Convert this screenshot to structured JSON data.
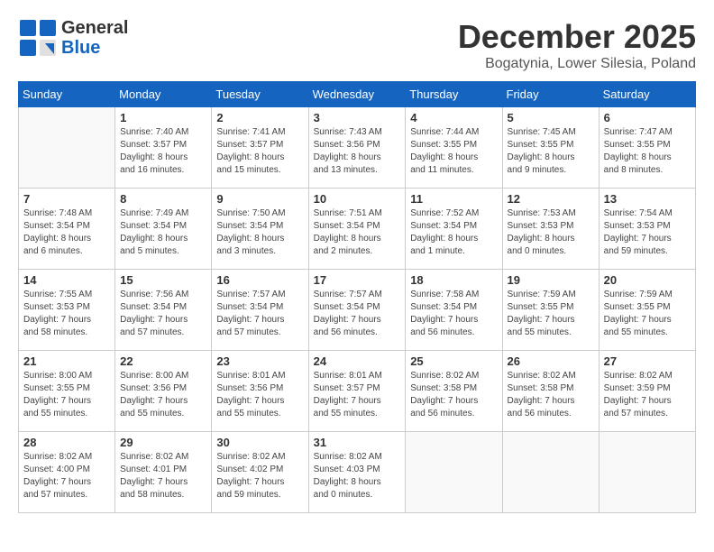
{
  "header": {
    "logo_line1": "General",
    "logo_line2": "Blue",
    "month": "December 2025",
    "location": "Bogatynia, Lower Silesia, Poland"
  },
  "weekdays": [
    "Sunday",
    "Monday",
    "Tuesday",
    "Wednesday",
    "Thursday",
    "Friday",
    "Saturday"
  ],
  "weeks": [
    [
      {
        "day": "",
        "info": ""
      },
      {
        "day": "1",
        "info": "Sunrise: 7:40 AM\nSunset: 3:57 PM\nDaylight: 8 hours\nand 16 minutes."
      },
      {
        "day": "2",
        "info": "Sunrise: 7:41 AM\nSunset: 3:57 PM\nDaylight: 8 hours\nand 15 minutes."
      },
      {
        "day": "3",
        "info": "Sunrise: 7:43 AM\nSunset: 3:56 PM\nDaylight: 8 hours\nand 13 minutes."
      },
      {
        "day": "4",
        "info": "Sunrise: 7:44 AM\nSunset: 3:55 PM\nDaylight: 8 hours\nand 11 minutes."
      },
      {
        "day": "5",
        "info": "Sunrise: 7:45 AM\nSunset: 3:55 PM\nDaylight: 8 hours\nand 9 minutes."
      },
      {
        "day": "6",
        "info": "Sunrise: 7:47 AM\nSunset: 3:55 PM\nDaylight: 8 hours\nand 8 minutes."
      }
    ],
    [
      {
        "day": "7",
        "info": "Sunrise: 7:48 AM\nSunset: 3:54 PM\nDaylight: 8 hours\nand 6 minutes."
      },
      {
        "day": "8",
        "info": "Sunrise: 7:49 AM\nSunset: 3:54 PM\nDaylight: 8 hours\nand 5 minutes."
      },
      {
        "day": "9",
        "info": "Sunrise: 7:50 AM\nSunset: 3:54 PM\nDaylight: 8 hours\nand 3 minutes."
      },
      {
        "day": "10",
        "info": "Sunrise: 7:51 AM\nSunset: 3:54 PM\nDaylight: 8 hours\nand 2 minutes."
      },
      {
        "day": "11",
        "info": "Sunrise: 7:52 AM\nSunset: 3:54 PM\nDaylight: 8 hours\nand 1 minute."
      },
      {
        "day": "12",
        "info": "Sunrise: 7:53 AM\nSunset: 3:53 PM\nDaylight: 8 hours\nand 0 minutes."
      },
      {
        "day": "13",
        "info": "Sunrise: 7:54 AM\nSunset: 3:53 PM\nDaylight: 7 hours\nand 59 minutes."
      }
    ],
    [
      {
        "day": "14",
        "info": "Sunrise: 7:55 AM\nSunset: 3:53 PM\nDaylight: 7 hours\nand 58 minutes."
      },
      {
        "day": "15",
        "info": "Sunrise: 7:56 AM\nSunset: 3:54 PM\nDaylight: 7 hours\nand 57 minutes."
      },
      {
        "day": "16",
        "info": "Sunrise: 7:57 AM\nSunset: 3:54 PM\nDaylight: 7 hours\nand 57 minutes."
      },
      {
        "day": "17",
        "info": "Sunrise: 7:57 AM\nSunset: 3:54 PM\nDaylight: 7 hours\nand 56 minutes."
      },
      {
        "day": "18",
        "info": "Sunrise: 7:58 AM\nSunset: 3:54 PM\nDaylight: 7 hours\nand 56 minutes."
      },
      {
        "day": "19",
        "info": "Sunrise: 7:59 AM\nSunset: 3:55 PM\nDaylight: 7 hours\nand 55 minutes."
      },
      {
        "day": "20",
        "info": "Sunrise: 7:59 AM\nSunset: 3:55 PM\nDaylight: 7 hours\nand 55 minutes."
      }
    ],
    [
      {
        "day": "21",
        "info": "Sunrise: 8:00 AM\nSunset: 3:55 PM\nDaylight: 7 hours\nand 55 minutes."
      },
      {
        "day": "22",
        "info": "Sunrise: 8:00 AM\nSunset: 3:56 PM\nDaylight: 7 hours\nand 55 minutes."
      },
      {
        "day": "23",
        "info": "Sunrise: 8:01 AM\nSunset: 3:56 PM\nDaylight: 7 hours\nand 55 minutes."
      },
      {
        "day": "24",
        "info": "Sunrise: 8:01 AM\nSunset: 3:57 PM\nDaylight: 7 hours\nand 55 minutes."
      },
      {
        "day": "25",
        "info": "Sunrise: 8:02 AM\nSunset: 3:58 PM\nDaylight: 7 hours\nand 56 minutes."
      },
      {
        "day": "26",
        "info": "Sunrise: 8:02 AM\nSunset: 3:58 PM\nDaylight: 7 hours\nand 56 minutes."
      },
      {
        "day": "27",
        "info": "Sunrise: 8:02 AM\nSunset: 3:59 PM\nDaylight: 7 hours\nand 57 minutes."
      }
    ],
    [
      {
        "day": "28",
        "info": "Sunrise: 8:02 AM\nSunset: 4:00 PM\nDaylight: 7 hours\nand 57 minutes."
      },
      {
        "day": "29",
        "info": "Sunrise: 8:02 AM\nSunset: 4:01 PM\nDaylight: 7 hours\nand 58 minutes."
      },
      {
        "day": "30",
        "info": "Sunrise: 8:02 AM\nSunset: 4:02 PM\nDaylight: 7 hours\nand 59 minutes."
      },
      {
        "day": "31",
        "info": "Sunrise: 8:02 AM\nSunset: 4:03 PM\nDaylight: 8 hours\nand 0 minutes."
      },
      {
        "day": "",
        "info": ""
      },
      {
        "day": "",
        "info": ""
      },
      {
        "day": "",
        "info": ""
      }
    ]
  ]
}
